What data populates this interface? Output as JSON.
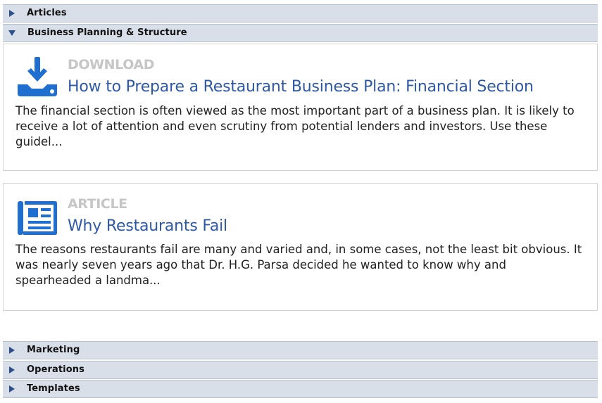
{
  "accordion": {
    "articles": {
      "label": "Articles",
      "state": "collapsed"
    },
    "business": {
      "label": "Business Planning & Structure",
      "state": "expanded"
    },
    "marketing": {
      "label": "Marketing",
      "state": "collapsed"
    },
    "operations": {
      "label": "Operations",
      "state": "collapsed"
    },
    "templates": {
      "label": "Templates",
      "state": "collapsed"
    }
  },
  "items": [
    {
      "type": "DOWNLOAD",
      "icon": "download-icon",
      "title": "How to Prepare a Restaurant Business Plan: Financial Section",
      "desc": "The financial section is often viewed as the most important part of a business plan. It is likely to receive a lot of attention and even scrutiny from potential lenders and investors. Use these guidel..."
    },
    {
      "type": "ARTICLE",
      "icon": "newspaper-icon",
      "title": "Why Restaurants Fail",
      "desc": "The reasons restaurants fail are many and varied and, in some cases, not the least bit obvious. It was nearly seven years ago that Dr. H.G. Parsa decided he wanted to know why and spearheaded a landma..."
    }
  ],
  "colors": {
    "header_bg": "#d9dfe8",
    "arrow": "#2d4f8c",
    "title_link": "#2f58a6",
    "type_label": "#c6c6c6",
    "icon": "#1f6fd0"
  }
}
